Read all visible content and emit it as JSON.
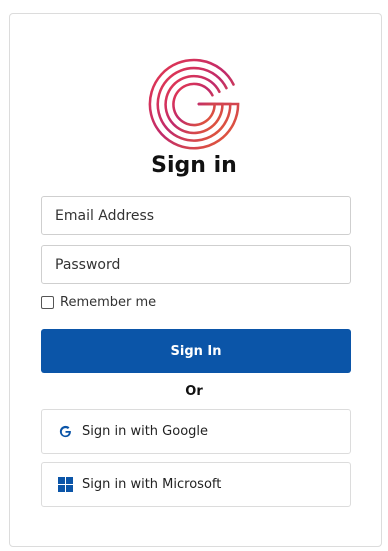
{
  "login": {
    "title": "Sign in",
    "email_placeholder": "Email Address",
    "password_placeholder": "Password",
    "remember_label": "Remember me",
    "remember_checked": false,
    "submit_label": "Sign In",
    "separator": "Or",
    "google_label": "Sign in with Google",
    "microsoft_label": "Sign in with Microsoft"
  },
  "icons": {
    "logo": "brand-g-logo-icon",
    "google": "google-icon",
    "microsoft": "microsoft-icon"
  },
  "colors": {
    "primary": "#0b55a8",
    "logo_gradient": [
      "#e6394f",
      "#c02a6a",
      "#e8622f"
    ]
  }
}
